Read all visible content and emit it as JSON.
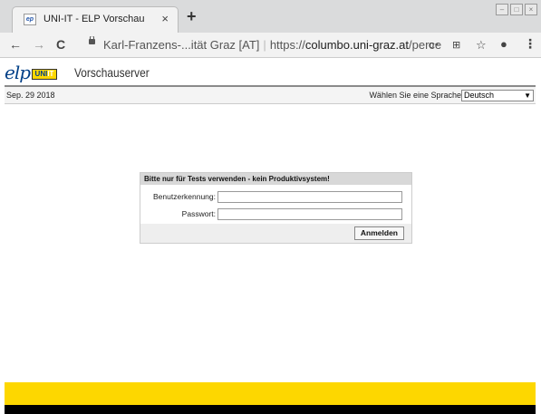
{
  "browser": {
    "tab_title": "UNI-IT - ELP Vorschau",
    "tab_favicon": "ep",
    "tab_close": "×",
    "new_tab": "+",
    "back": "←",
    "forward": "→",
    "reload": "C",
    "url_host": "Karl-Franzens-...ität Graz [AT]",
    "url_separator": "|",
    "url_scheme": "https://",
    "url_domain": "columbo.uni-graz.at",
    "url_path": "/perce...",
    "key_icon": "o⁃",
    "translate_icon": "⊞",
    "star_icon": "☆",
    "account_icon": "●",
    "menu_icon": "⋮"
  },
  "header": {
    "logo_text": "elp",
    "logo_badge_a": "UNI",
    "logo_badge_b": "IT",
    "app_name": "Vorschauserver"
  },
  "infobar": {
    "date": "Sep. 29 2018",
    "language_label": "Wählen Sie eine Sprache",
    "language_value": "Deutsch",
    "language_arrow": "▼"
  },
  "login": {
    "heading": "Bitte nur für Tests verwenden - kein Produktivsystem!",
    "username_label": "Benutzerkennung:",
    "password_label": "Passwort:",
    "submit_label": "Anmelden"
  },
  "colors": {
    "accent_yellow": "#fdd700",
    "brand_blue": "#003f87"
  }
}
